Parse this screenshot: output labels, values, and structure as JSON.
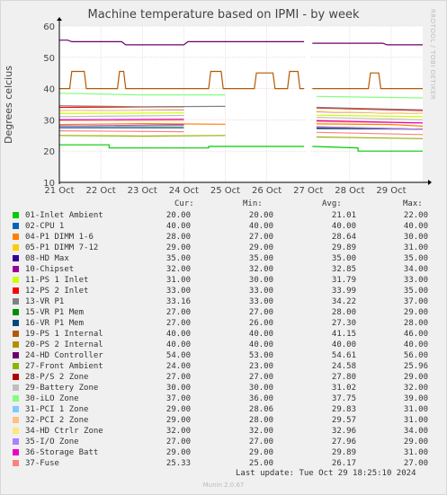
{
  "title": "Machine temperature based on IPMI - by week",
  "vendor": "RRDTOOL / TOBI OETIKER",
  "legend_headers": {
    "cur": "Cur:",
    "min": "Min:",
    "avg": "Avg:",
    "max": "Max:"
  },
  "last_update": "Last update: Tue Oct 29 18:25:10 2024",
  "munin": "Munin 2.0.67",
  "colors": {
    "grid": "#e0c8c8",
    "axis": "#000000",
    "background": "#ffffff"
  },
  "chart_data": {
    "type": "line",
    "title": "Machine temperature based on IPMI - by week",
    "ylabel": "Degrees celcius",
    "xlabel": "",
    "ylim": [
      10,
      60
    ],
    "yticks": [
      10,
      20,
      30,
      40,
      50,
      60
    ],
    "xlim": [
      0,
      8.76
    ],
    "x_tick_labels": [
      "21 Oct",
      "22 Oct",
      "23 Oct",
      "24 Oct",
      "25 Oct",
      "26 Oct",
      "27 Oct",
      "28 Oct",
      "29 Oct"
    ],
    "grid": true,
    "gap": [
      5.95,
      6.05
    ],
    "legend_placement": "bottom",
    "series": [
      {
        "name": "01-Inlet Ambient",
        "color": "#00cc00",
        "cur": "20.00",
        "min": "20.00",
        "avg": "21.01",
        "max": "22.00",
        "x": [
          0,
          1.2,
          1.2,
          3.6,
          3.6,
          5.9,
          6.1,
          7.2,
          7.2,
          8.76
        ],
        "y": [
          22,
          22,
          21,
          21,
          21.5,
          21.5,
          21.5,
          21,
          20,
          20
        ]
      },
      {
        "name": "02-CPU 1",
        "color": "#0066b3",
        "cur": "40.00",
        "min": "40.00",
        "avg": "40.00",
        "max": "40.00",
        "x": [
          0,
          8.76
        ],
        "y": [
          40,
          40
        ]
      },
      {
        "name": "04-P1 DIMM 1-6",
        "color": "#ff8000",
        "cur": "28.00",
        "min": "27.00",
        "avg": "28.64",
        "max": "30.00",
        "x": [
          0,
          2,
          4,
          6.2,
          8,
          8.76
        ],
        "y": [
          28.5,
          28.8,
          28.6,
          28.7,
          28.5,
          28
        ]
      },
      {
        "name": "05-P1 DIMM 7-12",
        "color": "#ffcc00",
        "cur": "29.00",
        "min": "29.00",
        "avg": "29.89",
        "max": "31.00",
        "x": [
          0,
          3,
          6.2,
          8.76
        ],
        "y": [
          30,
          30.2,
          29.8,
          29
        ]
      },
      {
        "name": "08-HD Max",
        "color": "#330099",
        "cur": "35.00",
        "min": "35.00",
        "avg": "35.00",
        "max": "35.00",
        "x": [
          0,
          8.76
        ],
        "y": [
          35,
          35
        ]
      },
      {
        "name": "10-Chipset",
        "color": "#990099",
        "cur": "32.00",
        "min": "32.00",
        "avg": "32.85",
        "max": "34.00",
        "x": [
          0,
          3,
          6.2,
          8.76
        ],
        "y": [
          33,
          33.2,
          32.6,
          32
        ]
      },
      {
        "name": "11-PS 1 Inlet",
        "color": "#ccff00",
        "cur": "31.00",
        "min": "30.00",
        "avg": "31.79",
        "max": "33.00",
        "x": [
          0,
          3,
          6.2,
          8.76
        ],
        "y": [
          32,
          32.2,
          31.5,
          31
        ]
      },
      {
        "name": "12-PS 2 Inlet",
        "color": "#ff0000",
        "cur": "33.00",
        "min": "33.00",
        "avg": "33.99",
        "max": "35.00",
        "x": [
          0,
          3,
          6.2,
          8.76
        ],
        "y": [
          34,
          34.2,
          33.8,
          33
        ]
      },
      {
        "name": "13-VR P1",
        "color": "#808080",
        "cur": "33.16",
        "min": "33.00",
        "avg": "34.22",
        "max": "37.00",
        "x": [
          0,
          2,
          4,
          6.2,
          8.76
        ],
        "y": [
          34.5,
          34.2,
          34.3,
          34,
          33.2
        ]
      },
      {
        "name": "15-VR P1 Mem",
        "color": "#008f00",
        "cur": "27.00",
        "min": "27.00",
        "avg": "28.00",
        "max": "29.00",
        "x": [
          0,
          3,
          6.2,
          8.76
        ],
        "y": [
          28,
          28.2,
          27.8,
          27
        ]
      },
      {
        "name": "16-VR P1 Mem",
        "color": "#00487d",
        "cur": "27.00",
        "min": "26.00",
        "avg": "27.30",
        "max": "28.00",
        "x": [
          0,
          3,
          6.2,
          8.76
        ],
        "y": [
          27.5,
          27.5,
          27.2,
          27
        ]
      },
      {
        "name": "19-PS 1 Internal",
        "color": "#b35a00",
        "cur": "40.00",
        "min": "40.00",
        "avg": "41.15",
        "max": "46.00",
        "x": [
          0,
          0.25,
          0.3,
          0.6,
          0.65,
          1.4,
          1.45,
          1.55,
          1.6,
          3.6,
          3.65,
          3.9,
          3.95,
          4.7,
          4.75,
          5.15,
          5.2,
          5.5,
          5.55,
          5.75,
          5.8,
          5.9,
          6.1,
          6.4,
          6.45,
          7.45,
          7.5,
          7.7,
          7.75,
          8.76
        ],
        "y": [
          40,
          40,
          45.5,
          45.5,
          40,
          40,
          45.5,
          45.5,
          40,
          40,
          45.5,
          45.5,
          40,
          40,
          45,
          45,
          40,
          40,
          45.5,
          45.5,
          40,
          40,
          40,
          40,
          40,
          40,
          45,
          45,
          40,
          40
        ]
      },
      {
        "name": "20-PS 2 Internal",
        "color": "#b38f00",
        "cur": "40.00",
        "min": "40.00",
        "avg": "40.00",
        "max": "40.00",
        "x": [
          0,
          8.76
        ],
        "y": [
          40,
          40
        ]
      },
      {
        "name": "24-HD Controller",
        "color": "#6b006b",
        "cur": "54.00",
        "min": "53.00",
        "avg": "54.61",
        "max": "56.00",
        "x": [
          0,
          0.2,
          0.3,
          1.5,
          1.6,
          3.0,
          3.1,
          5.9,
          6.1,
          7.8,
          7.9,
          8.76
        ],
        "y": [
          55.5,
          55.5,
          55,
          55,
          54,
          54,
          55,
          55,
          54.5,
          54.5,
          54,
          54
        ]
      },
      {
        "name": "27-Front Ambient",
        "color": "#8fb300",
        "cur": "24.00",
        "min": "23.00",
        "avg": "24.58",
        "max": "25.96",
        "x": [
          0,
          2,
          4,
          6.2,
          8.76
        ],
        "y": [
          25,
          24.8,
          25,
          24.5,
          24
        ]
      },
      {
        "name": "28-P/S 2 Zone",
        "color": "#b30000",
        "cur": "27.00",
        "min": "27.00",
        "avg": "27.80",
        "max": "29.00",
        "x": [
          0,
          3,
          6.2,
          8.76
        ],
        "y": [
          28,
          28.4,
          27.6,
          27
        ]
      },
      {
        "name": "29-Battery Zone",
        "color": "#bebebe",
        "cur": "30.00",
        "min": "30.00",
        "avg": "31.02",
        "max": "32.00",
        "x": [
          0,
          3,
          6.2,
          8.76
        ],
        "y": [
          31,
          31.4,
          30.8,
          30
        ]
      },
      {
        "name": "30-iLO Zone",
        "color": "#80ff80",
        "cur": "37.00",
        "min": "36.00",
        "avg": "37.75",
        "max": "39.00",
        "x": [
          0,
          2,
          4,
          6.2,
          8.76
        ],
        "y": [
          38.5,
          38,
          38,
          37.5,
          37
        ]
      },
      {
        "name": "31-PCI 1 Zone",
        "color": "#80c9ff",
        "cur": "29.00",
        "min": "28.06",
        "avg": "29.83",
        "max": "31.00",
        "x": [
          0,
          3,
          6.2,
          8.76
        ],
        "y": [
          30,
          30,
          29.6,
          29
        ]
      },
      {
        "name": "32-PCI 2 Zone",
        "color": "#ffc080",
        "cur": "29.00",
        "min": "28.00",
        "avg": "29.57",
        "max": "31.00",
        "x": [
          0,
          3,
          6.2,
          8.76
        ],
        "y": [
          29.7,
          29.8,
          29.4,
          29
        ]
      },
      {
        "name": "34-HD Ctrlr Zone",
        "color": "#ffe680",
        "cur": "32.00",
        "min": "32.00",
        "avg": "32.96",
        "max": "34.00",
        "x": [
          0,
          3,
          6.2,
          8.76
        ],
        "y": [
          33,
          33.3,
          32.7,
          32
        ]
      },
      {
        "name": "35-I/O Zone",
        "color": "#aa80ff",
        "cur": "27.00",
        "min": "27.00",
        "avg": "27.96",
        "max": "29.00",
        "x": [
          0,
          3,
          6.2,
          8.76
        ],
        "y": [
          28,
          28.3,
          27.7,
          27
        ]
      },
      {
        "name": "36-Storage Batt",
        "color": "#ee00cc",
        "cur": "29.00",
        "min": "29.00",
        "avg": "29.89",
        "max": "31.00",
        "x": [
          0,
          3,
          6.2,
          8.76
        ],
        "y": [
          30,
          30.2,
          29.7,
          29
        ]
      },
      {
        "name": "37-Fuse",
        "color": "#ff8080",
        "cur": "25.33",
        "min": "25.00",
        "avg": "26.17",
        "max": "27.00",
        "x": [
          0,
          3,
          6.2,
          8.76
        ],
        "y": [
          26.5,
          26.2,
          26,
          25.3
        ]
      }
    ]
  }
}
